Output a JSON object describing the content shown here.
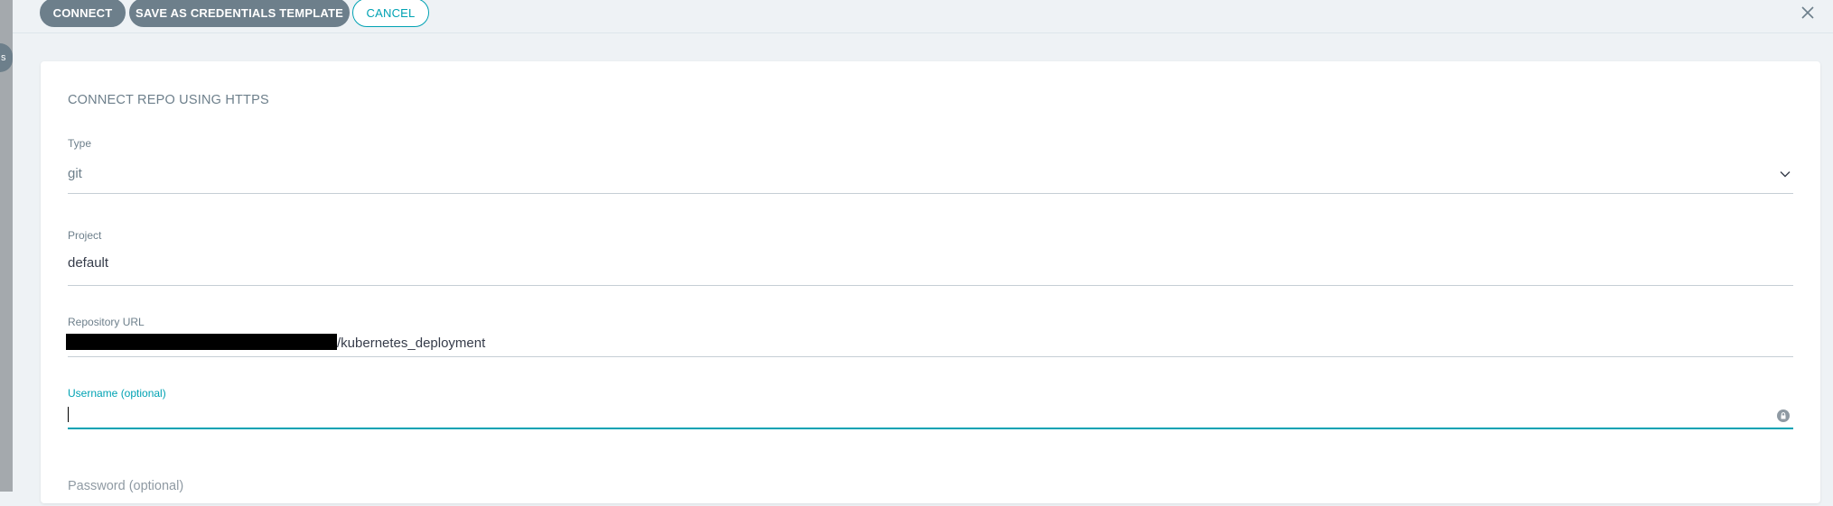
{
  "toolbar": {
    "connect_label": "CONNECT",
    "save_template_label": "SAVE AS CREDENTIALS TEMPLATE",
    "cancel_label": "CANCEL",
    "close_icon": "close-icon"
  },
  "sidebar_tab": {
    "glyph": "s"
  },
  "form": {
    "title": "CONNECT REPO USING HTTPS",
    "type": {
      "label": "Type",
      "value": "git"
    },
    "project": {
      "label": "Project",
      "value": "default"
    },
    "repo_url": {
      "label": "Repository URL",
      "value_suffix": "/kubernetes_deployment"
    },
    "username": {
      "label": "Username (optional)",
      "value": ""
    },
    "password": {
      "label": "Password (optional)"
    }
  },
  "colors": {
    "accent": "#00a2b3",
    "button_dark": "#6d7f8b",
    "background": "#eef2f5"
  }
}
